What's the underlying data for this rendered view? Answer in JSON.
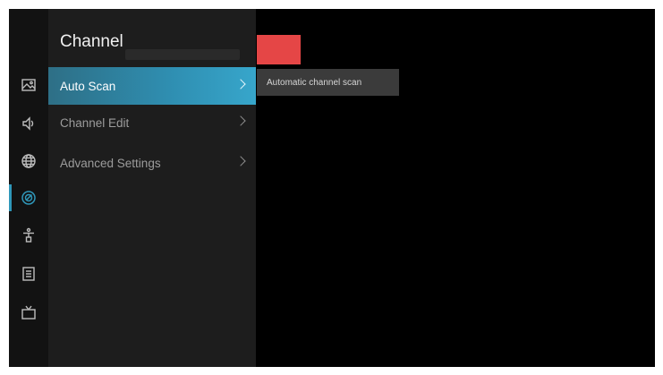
{
  "colors": {
    "accent": "#2f97b9",
    "selected_start": "#2e6f86",
    "selected_end": "#37a6cb",
    "red_block": "#e54646",
    "panel_bg": "#1d1d1d",
    "rail_bg": "#121212",
    "hint_bg": "#3b3b3b"
  },
  "sidebar": {
    "icons": [
      {
        "name": "picture-icon",
        "active": false
      },
      {
        "name": "sound-icon",
        "active": false
      },
      {
        "name": "network-globe-icon",
        "active": false
      },
      {
        "name": "channel-dish-icon",
        "active": true
      },
      {
        "name": "accessibility-icon",
        "active": false
      },
      {
        "name": "system-list-icon",
        "active": false
      },
      {
        "name": "tv-icon",
        "active": false
      }
    ]
  },
  "menu": {
    "title": "Channel",
    "items": [
      {
        "label": "Auto Scan",
        "selected": true
      },
      {
        "label": "Channel Edit",
        "selected": false
      },
      {
        "label": "Advanced Settings",
        "selected": false
      }
    ]
  },
  "hint": {
    "text": "Automatic channel scan"
  }
}
